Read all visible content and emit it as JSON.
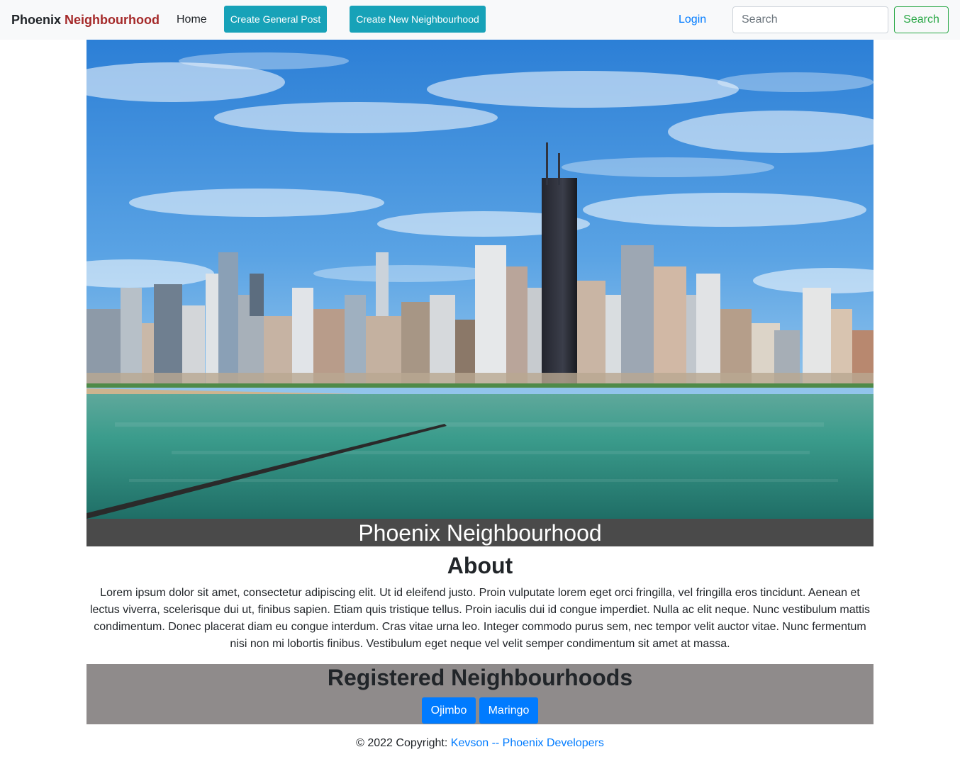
{
  "navbar": {
    "brand_part1": "Phoenix",
    "brand_part2": "Neighbourhood",
    "home_label": "Home",
    "create_general_post_label": "Create General Post",
    "create_new_neighbourhood_label": "Create New Neighbourhood",
    "login_label": "Login",
    "search_placeholder": "Search",
    "search_value": "",
    "search_button_label": "Search"
  },
  "hero": {
    "caption": "Phoenix Neighbourhood"
  },
  "about": {
    "title": "About",
    "text": "Lorem ipsum dolor sit amet, consectetur adipiscing elit. Ut id eleifend justo. Proin vulputate lorem eget orci fringilla, vel fringilla eros tincidunt. Aenean et lectus viverra, scelerisque dui ut, finibus sapien. Etiam quis tristique tellus. Proin iaculis dui id congue imperdiet. Nulla ac elit neque. Nunc vestibulum mattis condimentum. Donec placerat diam eu congue interdum. Cras vitae urna leo. Integer commodo purus sem, nec tempor velit auctor vitae. Nunc fermentum nisi non mi lobortis finibus. Vestibulum eget neque vel velit semper condimentum sit amet at massa."
  },
  "registered": {
    "title": "Registered Neighbourhoods",
    "items": [
      {
        "label": "Ojimbo"
      },
      {
        "label": "Maringo"
      }
    ]
  },
  "footer": {
    "copyright_text": "© 2022 Copyright:",
    "link_text": "Kevson -- Phoenix Developers"
  },
  "colors": {
    "brand_accent": "#a52a2a",
    "info_button": "#17a2b8",
    "primary": "#007bff",
    "success": "#28a745",
    "caption_band": "#4a4a4a",
    "registered_band": "#8f8b8b"
  }
}
